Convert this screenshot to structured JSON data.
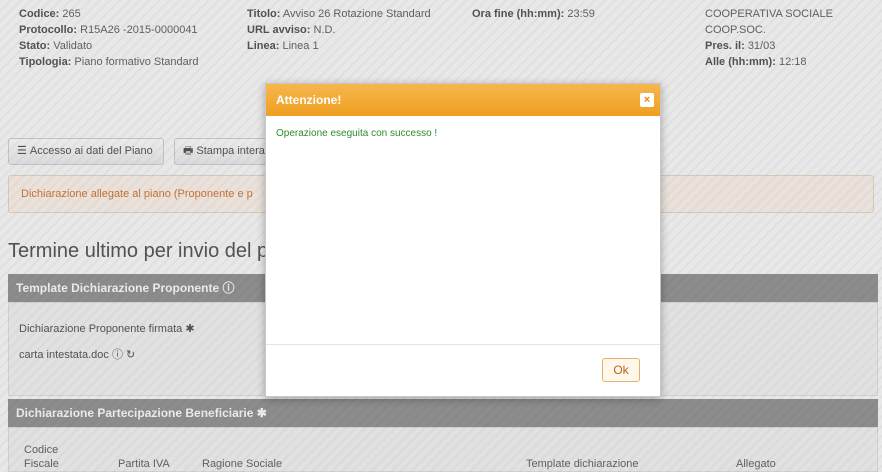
{
  "header": {
    "col1": [
      {
        "label": "Codice:",
        "value": "265"
      },
      {
        "label": "Protocollo:",
        "value": "R15A26 -2015-0000041"
      },
      {
        "label": "Stato:",
        "value": "Validato"
      },
      {
        "label": "Tipologia:",
        "value": "Piano formativo Standard"
      }
    ],
    "col2": [
      {
        "label": "Titolo:",
        "value": "Avviso 26 Rotazione Standard"
      },
      {
        "label": "URL avviso:",
        "value": "N.D."
      },
      {
        "label": "Linea:",
        "value": "Linea 1"
      }
    ],
    "col3": [
      {
        "label": "Ora fine (hh:mm):",
        "value": "23:59"
      }
    ],
    "col4": {
      "org_line1": "COOPERATIVA SOCIALE",
      "org_line2": "COOP.SOC.",
      "pres_label": "Pres. il:",
      "pres_value": "31/03",
      "alle_label": "Alle (hh:mm):",
      "alle_value": "12:18"
    }
  },
  "buttons": {
    "access_label": "Accesso ai dati del Piano",
    "print_label": "Stampa intera"
  },
  "declarations_link": "Dichiarazione allegate al piano (Proponente e p",
  "main_title": "Termine ultimo per invio del pi",
  "section_proponente": {
    "title": "Template Dichiarazione Proponente",
    "signed_label": "Dichiarazione Proponente firmata",
    "file_name": "carta intestata.doc"
  },
  "section_beneficiarie": {
    "title": "Dichiarazione Partecipazione Beneficiarie",
    "columns": [
      "Codice",
      "Fiscale",
      "Partita IVA",
      "Ragione Sociale",
      "Template dichiarazione",
      "Allegato"
    ]
  },
  "modal": {
    "title": "Attenzione!",
    "message": "Operazione eseguita con successo !",
    "close_glyph": "×",
    "ok_label": "Ok"
  }
}
